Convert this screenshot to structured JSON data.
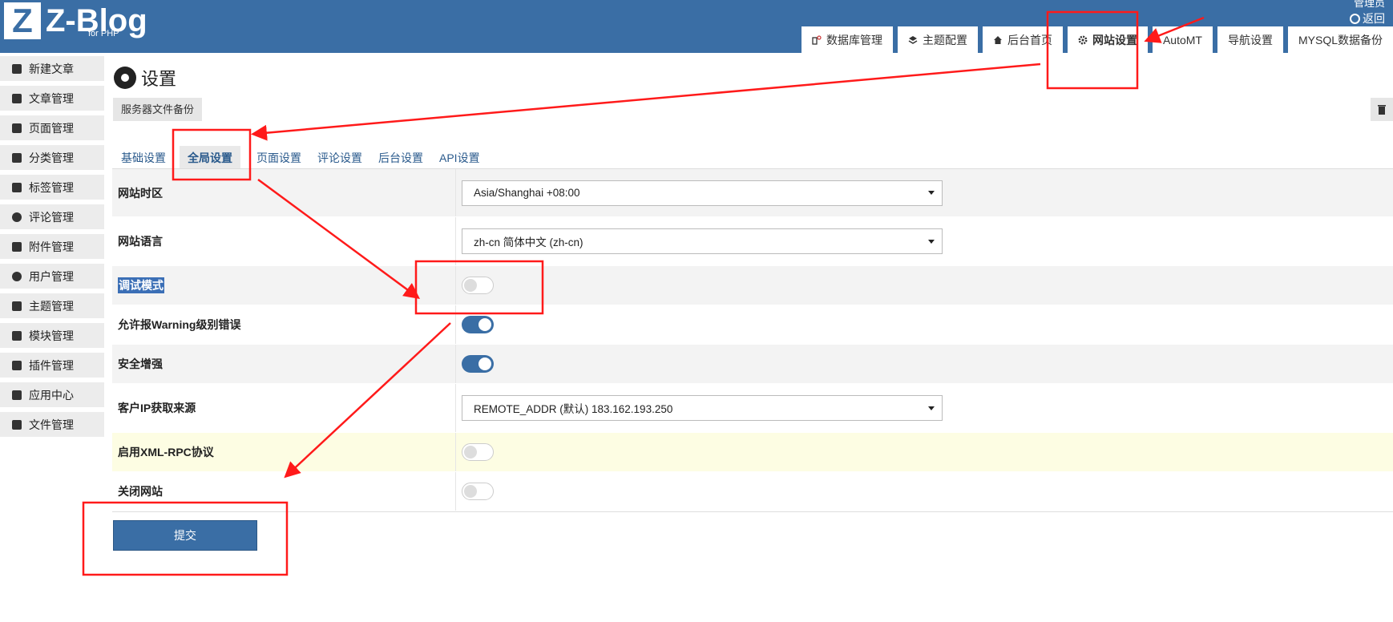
{
  "header": {
    "logo_letter": "Z",
    "logo_title": "Z-Blog",
    "logo_sub": "for PHP",
    "user_text": "管理员",
    "back_label": "返回",
    "nav": [
      {
        "label": "数据库管理",
        "icon": "database-icon"
      },
      {
        "label": "主题配置",
        "icon": "layers-icon"
      },
      {
        "label": "后台首页",
        "icon": "home-icon"
      },
      {
        "label": "网站设置",
        "icon": "gear-icon",
        "active": true
      },
      {
        "label": "AutoMT",
        "icon": ""
      },
      {
        "label": "导航设置",
        "icon": ""
      },
      {
        "label": "MYSQL数据备份",
        "icon": ""
      }
    ]
  },
  "sidebar": {
    "items": [
      {
        "label": "新建文章",
        "icon": "edit-icon"
      },
      {
        "label": "文章管理",
        "icon": "article-icon"
      },
      {
        "label": "页面管理",
        "icon": "page-icon"
      },
      {
        "label": "分类管理",
        "icon": "folder-icon"
      },
      {
        "label": "标签管理",
        "icon": "tag-icon"
      },
      {
        "label": "评论管理",
        "icon": "comment-icon"
      },
      {
        "label": "附件管理",
        "icon": "attachment-icon"
      },
      {
        "label": "用户管理",
        "icon": "users-icon"
      },
      {
        "label": "主题管理",
        "icon": "theme-icon"
      },
      {
        "label": "模块管理",
        "icon": "grid-icon"
      },
      {
        "label": "插件管理",
        "icon": "puzzle-icon"
      },
      {
        "label": "应用中心",
        "icon": "box-icon"
      },
      {
        "label": "文件管理",
        "icon": "file-icon"
      }
    ]
  },
  "main": {
    "title": "设置",
    "backup_label": "服务器文件备份",
    "trash_icon": "trash-icon",
    "subtabs": [
      "基础设置",
      "全局设置",
      "页面设置",
      "评论设置",
      "后台设置",
      "API设置"
    ],
    "active_subtab": "全局设置",
    "settings": [
      {
        "label": "网站时区",
        "type": "select",
        "value": "Asia/Shanghai +08:00"
      },
      {
        "label": "网站语言",
        "type": "select",
        "value": "zh-cn 简体中文 (zh-cn)"
      },
      {
        "label": "调试模式",
        "type": "toggle",
        "on": false
      },
      {
        "label": "允许报Warning级别错误",
        "type": "toggle",
        "on": true
      },
      {
        "label": "安全增强",
        "type": "toggle",
        "on": true
      },
      {
        "label": "客户IP获取来源",
        "type": "select",
        "value": "REMOTE_ADDR (默认) 183.162.193.250"
      },
      {
        "label": "启用XML-RPC协议",
        "type": "toggle",
        "on": false
      },
      {
        "label": "关闭网站",
        "type": "toggle",
        "on": false
      }
    ],
    "submit_label": "提交"
  },
  "colors": {
    "brand": "#3a6ea5",
    "annotation": "#ff1a1a"
  }
}
